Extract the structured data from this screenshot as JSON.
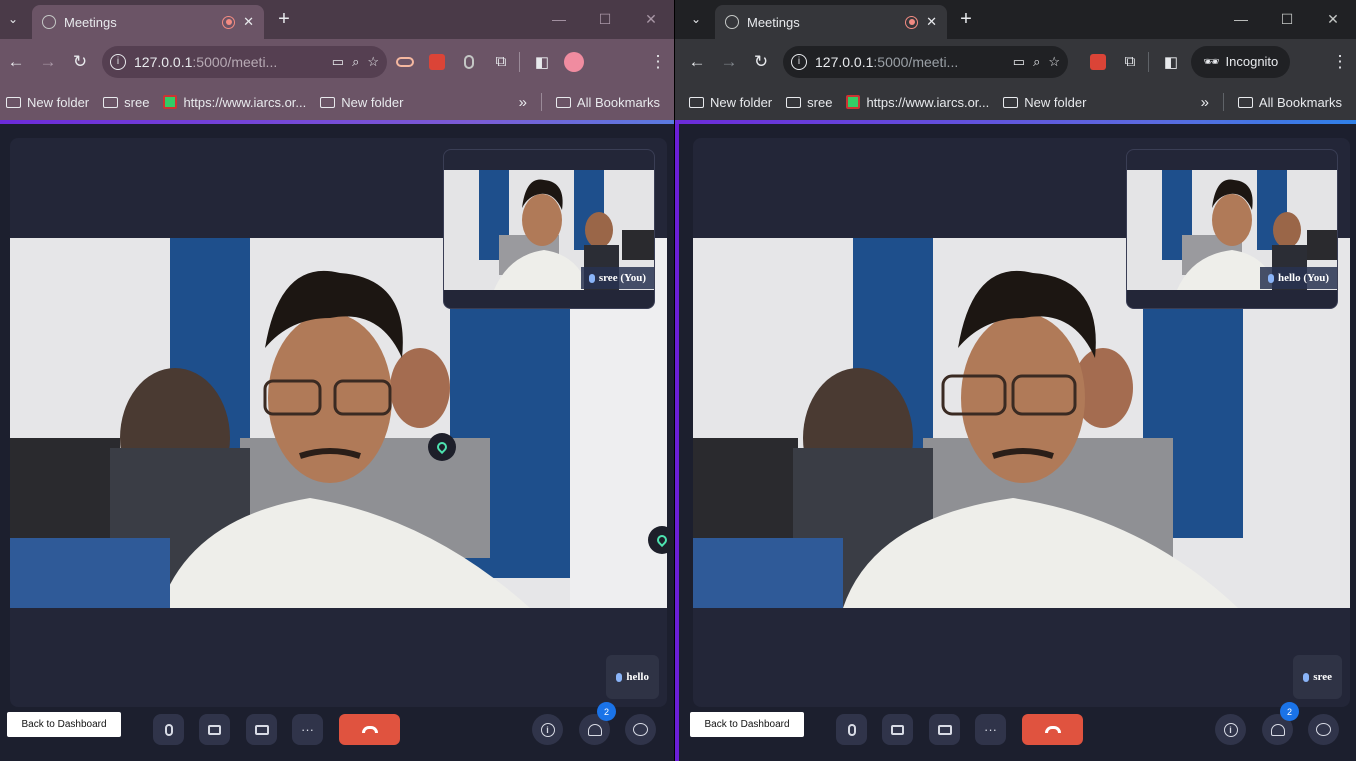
{
  "browser": {
    "tab_title": "Meetings",
    "url_host": "127.0.0.1",
    "url_path": ":5000/meeti...",
    "incognito_label": "Incognito",
    "bookmarks": [
      {
        "label": "New folder",
        "icon": "folder-icon"
      },
      {
        "label": "sree",
        "icon": "folder-icon"
      },
      {
        "label": "https://www.iarcs.or...",
        "icon": "site-icon"
      },
      {
        "label": "New folder",
        "icon": "folder-icon"
      }
    ],
    "all_bookmarks": "All Bookmarks"
  },
  "left": {
    "pip_label": "sree (You)",
    "remote_label": "hello"
  },
  "right": {
    "pip_label": "hello (You)",
    "remote_label": "sree"
  },
  "controls": {
    "back_label": "Back to Dashboard",
    "participants_count": "2"
  },
  "colors": {
    "accent_purple": "#6b1fd6",
    "end_call": "#e0533f",
    "badge_blue": "#1a73e8",
    "page_bg": "#1c1f2e"
  }
}
